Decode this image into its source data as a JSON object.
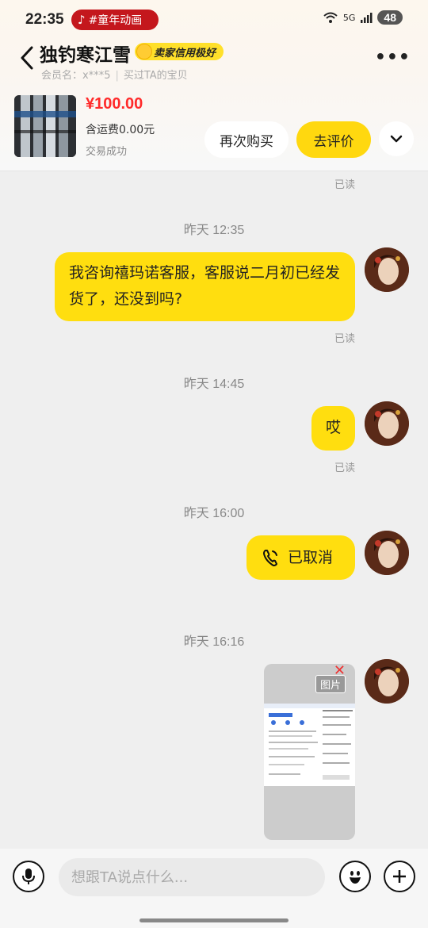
{
  "status_bar": {
    "time": "22:35",
    "app_pill": "#童年动画",
    "signal": "5G",
    "battery": "48"
  },
  "header": {
    "seller_name": "独钓寒江雪",
    "credit_badge": "卖家信用极好",
    "member_label": "会员名：x***5",
    "bought_label": "买过TA的宝贝"
  },
  "order": {
    "price": "¥100.00",
    "shipping": "含运费0.00元",
    "status": "交易成功",
    "rebuy_label": "再次购买",
    "review_label": "去评价"
  },
  "messages": [
    {
      "read": "已读"
    },
    {
      "time": "昨天 12:35",
      "text": "我咨询禧玛诺客服，客服说二月初已经发货了，还没到吗?",
      "read": "已读"
    },
    {
      "time": "昨天 14:45",
      "text": "哎",
      "read": "已读"
    },
    {
      "time": "昨天 16:00",
      "text": "已取消"
    },
    {
      "time": "昨天 16:16",
      "image_tag": "图片"
    }
  ],
  "input": {
    "placeholder": "想跟TA说点什么..."
  },
  "colors": {
    "bubble": "#ffde0f",
    "price": "#ff2a2a",
    "pill": "#c4171d"
  }
}
